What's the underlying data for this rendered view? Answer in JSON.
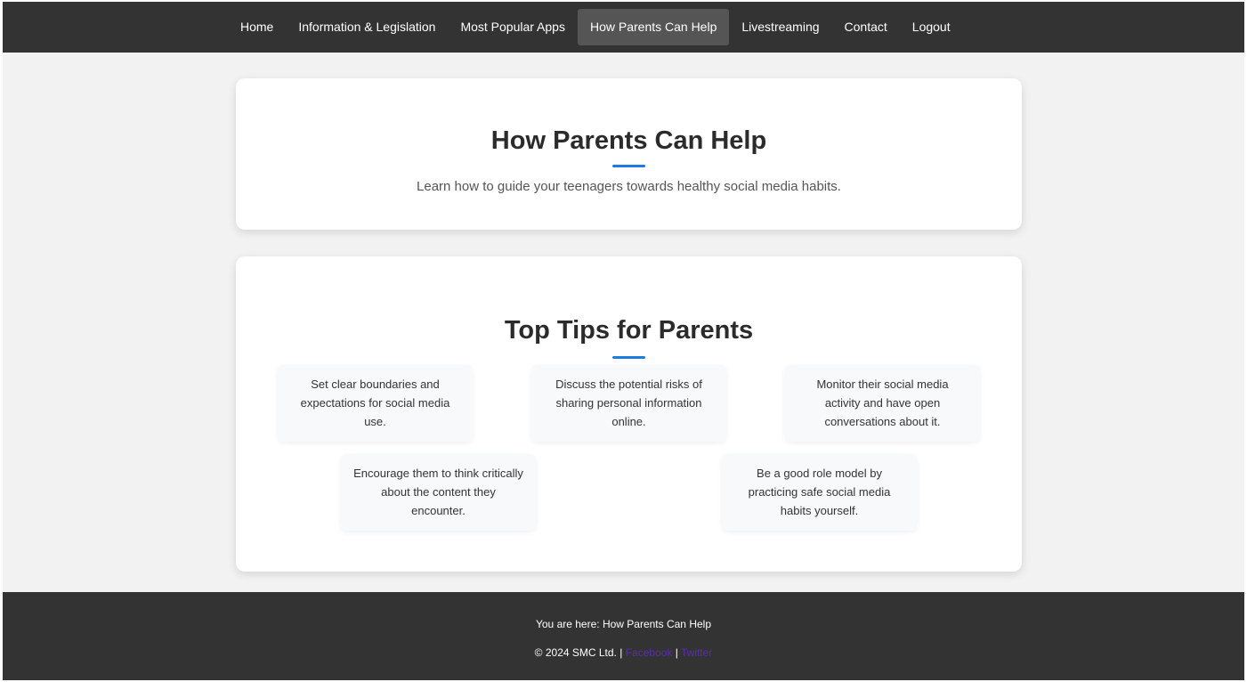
{
  "nav": {
    "items": [
      {
        "label": "Home",
        "active": false
      },
      {
        "label": "Information & Legislation",
        "active": false
      },
      {
        "label": "Most Popular Apps",
        "active": false
      },
      {
        "label": "How Parents Can Help",
        "active": true
      },
      {
        "label": "Livestreaming",
        "active": false
      },
      {
        "label": "Contact",
        "active": false
      },
      {
        "label": "Logout",
        "active": false
      }
    ]
  },
  "hero": {
    "title": "How Parents Can Help",
    "subtitle": "Learn how to guide your teenagers towards healthy social media habits."
  },
  "tips": {
    "title": "Top Tips for Parents",
    "items": [
      "Set clear boundaries and expectations for social media use.",
      "Discuss the potential risks of sharing personal information online.",
      "Monitor their social media activity and have open conversations about it.",
      "Encourage them to think critically about the content they encounter.",
      "Be a good role model by practicing safe social media habits yourself."
    ]
  },
  "footer": {
    "breadcrumb_prefix": "You are here: ",
    "breadcrumb_current": "How Parents Can Help",
    "copyright": "© 2024 SMC Ltd. | ",
    "separator": " | ",
    "links": [
      "Facebook",
      "Twitter"
    ]
  },
  "colors": {
    "nav_bg": "#333333",
    "nav_active_bg": "#555555",
    "page_bg": "#f2f2f2",
    "accent": "#1e7be0",
    "footer_link": "#5a2ea6"
  }
}
